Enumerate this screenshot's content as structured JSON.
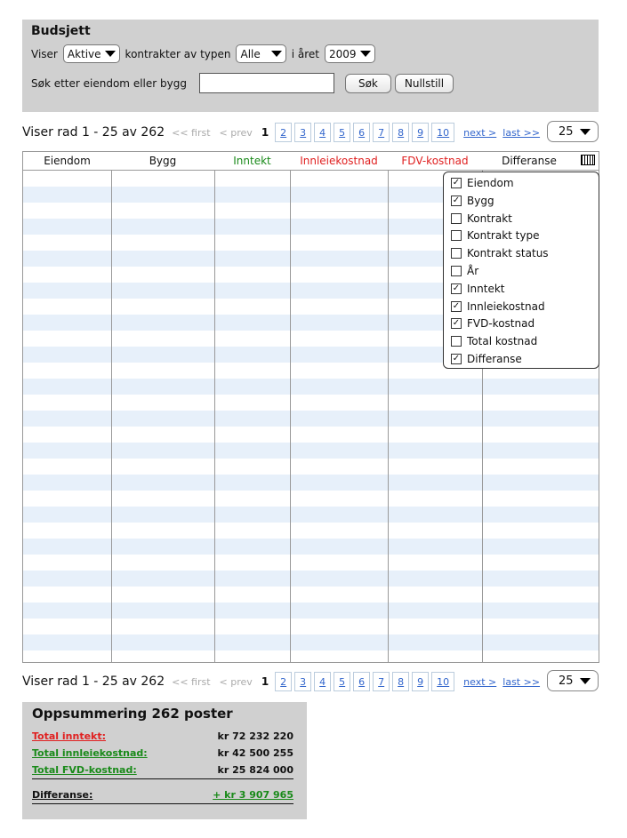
{
  "filter": {
    "title": "Budsjett",
    "viser_label": "Viser",
    "status_value": "Aktive",
    "kontrakter_label": "kontrakter av typen",
    "type_value": "Alle",
    "year_label": "i året",
    "year_value": "2009",
    "search_label": "Søk etter eiendom eller bygg",
    "search_value": "",
    "search_button": "Søk",
    "reset_button": "Nullstill"
  },
  "pager": {
    "count": "Viser rad 1 - 25 av 262",
    "first": "<< first",
    "prev": "< prev",
    "current": "1",
    "pages": [
      "2",
      "3",
      "4",
      "5",
      "6",
      "7",
      "8",
      "9",
      "10"
    ],
    "next": "next >",
    "last": "last >>",
    "page_size": "25"
  },
  "table": {
    "columns": [
      {
        "label": "Eiendom",
        "color": "#111111"
      },
      {
        "label": "Bygg",
        "color": "#111111"
      },
      {
        "label": "Inntekt",
        "color": "#1a8a1a"
      },
      {
        "label": "Innleiekostnad",
        "color": "#e02020"
      },
      {
        "label": "FDV-kostnad",
        "color": "#e02020"
      },
      {
        "label": "Differanse",
        "color": "#111111"
      }
    ]
  },
  "column_chooser": {
    "items": [
      {
        "label": "Eiendom",
        "checked": true
      },
      {
        "label": "Bygg",
        "checked": true
      },
      {
        "label": "Kontrakt",
        "checked": false
      },
      {
        "label": "Kontrakt type",
        "checked": false
      },
      {
        "label": "Kontrakt status",
        "checked": false
      },
      {
        "label": "År",
        "checked": false
      },
      {
        "label": "Inntekt",
        "checked": true
      },
      {
        "label": "Innleiekostnad",
        "checked": true
      },
      {
        "label": "FVD-kostnad",
        "checked": true
      },
      {
        "label": "Total kostnad",
        "checked": false
      },
      {
        "label": "Differanse",
        "checked": true
      }
    ]
  },
  "summary": {
    "title": "Oppsummering 262 poster",
    "rows": [
      {
        "label": "Total inntekt:",
        "value": "kr 72 232 220",
        "label_color": "#e02020"
      },
      {
        "label": "Total innleiekostnad:",
        "value": "kr 42 500 255",
        "label_color": "#1a8a1a"
      },
      {
        "label": "Total FVD-kostnad:",
        "value": "kr 25 824 000",
        "label_color": "#1a8a1a"
      }
    ],
    "diff_label": "Differanse:",
    "diff_value": "+ kr 3 907 965",
    "diff_color": "#1a8a1a"
  }
}
